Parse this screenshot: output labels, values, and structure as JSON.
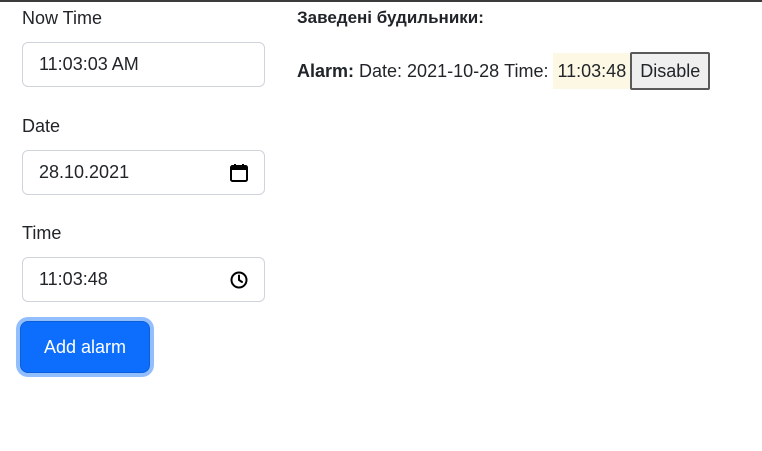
{
  "form": {
    "now_time_label": "Now Time",
    "now_time_value": "11:03:03 AM",
    "date_label": "Date",
    "date_value": "28.10.2021",
    "time_label": "Time",
    "time_value": "11:03:48",
    "add_button_label": "Add alarm"
  },
  "alarms": {
    "title": "Заведені будильники:",
    "items": [
      {
        "prefix": "Alarm:",
        "date_label": "Date:",
        "date": "2021-10-28",
        "time_label": "Time:",
        "time": "11:03:48",
        "disable_label": "Disable"
      }
    ]
  },
  "icons": {
    "date": "calendar-icon",
    "time": "clock-icon"
  },
  "colors": {
    "primary": "#0d6efd",
    "highlight": "#fcf8e3"
  }
}
